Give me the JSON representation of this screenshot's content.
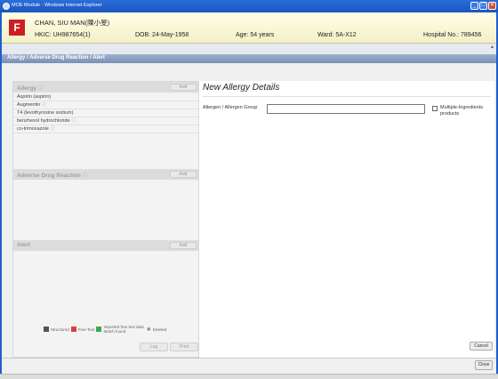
{
  "window": {
    "title": "MOE Module - Windows Internet Explorer",
    "buttons": [
      "_",
      "□",
      "✕"
    ]
  },
  "patient": {
    "sex": "F",
    "name": "CHAN, SIU MAN(陳小旻)",
    "hkic": "HKIC: UH987654(1)",
    "dob": "DOB: 24-May-1958",
    "age": "Age: 54 years",
    "ward": "Ward: 5A-X12",
    "hospital_no": "Hospital No.: 789456"
  },
  "module": {
    "header": "Allergy / Adverse Drug Reaction / Alert"
  },
  "left_panel": {
    "allergy": {
      "title": "Allergy",
      "add_label": "Add",
      "items": [
        {
          "name": "Aspirin (aspirin)",
          "info": false
        },
        {
          "name": "Augmentin",
          "info": true
        },
        {
          "name": "T4 (levothyroxine sodium)",
          "info": false
        },
        {
          "name": "benzhexol hydrochloride",
          "info": true
        },
        {
          "name": "co-trimoxazole",
          "info": true
        }
      ]
    },
    "adr": {
      "title": "Adverse Drug Reaction",
      "add_label": "Add"
    },
    "alert": {
      "title": "Alert",
      "add_label": "Add"
    },
    "legend": {
      "structured": "Structured",
      "free_text": "Free Text",
      "imported_line1": "Imported free text data",
      "imported_line2": "Match found",
      "deleted": "Deleted",
      "colors": {
        "structured": "#555555",
        "free_text": "#d94040",
        "imported": "#3aaa50"
      }
    },
    "log_label": "Log",
    "print_label": "Print"
  },
  "right_panel": {
    "heading": "New Allergy Details",
    "allergen_label": "Allergen / Allergen Group",
    "allergen_value": "",
    "multi_ingredient_label": "Multiple-Ingredients products",
    "multi_ingredient_checked": false,
    "cancel_label": "Cancel"
  },
  "footer": {
    "close_label": "Close"
  }
}
